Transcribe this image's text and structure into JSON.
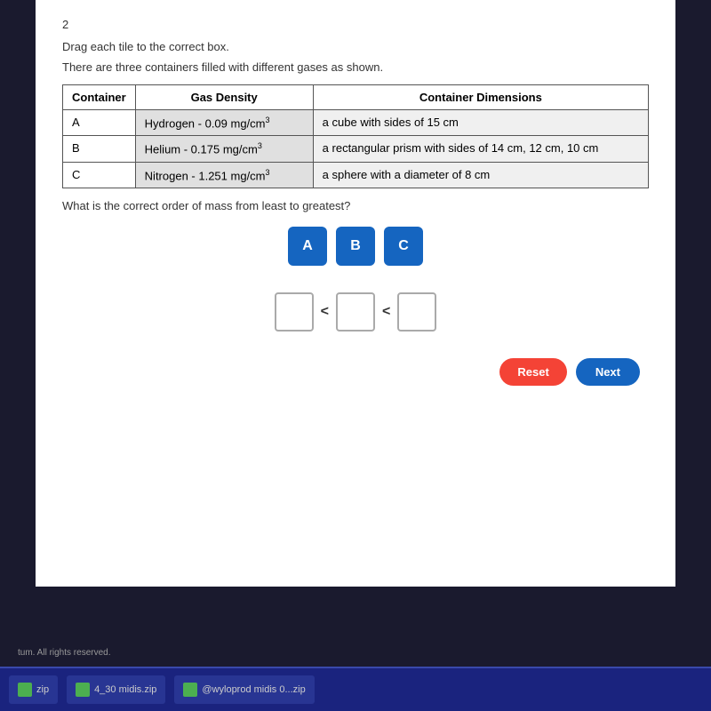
{
  "page": {
    "question_number": "2",
    "instruction": "Drag each tile to the correct box.",
    "sub_instruction": "There are three containers filled with different gases as shown.",
    "question_text": "What is the correct order of mass from least to greatest?"
  },
  "table": {
    "headers": [
      "Container",
      "Gas Density",
      "Container Dimensions"
    ],
    "rows": [
      {
        "container": "A",
        "gas_density": "Hydrogen - 0.09 mg/cm³",
        "dimensions": "a cube with sides of 15 cm"
      },
      {
        "container": "B",
        "gas_density": "Helium - 0.175 mg/cm³",
        "dimensions": "a rectangular prism with sides of 14 cm, 12 cm, 10 cm"
      },
      {
        "container": "C",
        "gas_density": "Nitrogen - 1.251 mg/cm³",
        "dimensions": "a sphere with a diameter of 8 cm"
      }
    ]
  },
  "tiles": [
    "A",
    "B",
    "C"
  ],
  "less_than_symbols": [
    "<",
    "<"
  ],
  "buttons": {
    "reset_label": "Reset",
    "next_label": "Next"
  },
  "taskbar": {
    "items": [
      {
        "label": "zip",
        "icon_type": "green"
      },
      {
        "label": "4_30 midis.zip",
        "icon_type": "green"
      },
      {
        "label": "@wyloprod midis 0...zip",
        "icon_type": "green"
      }
    ]
  },
  "copyright": "tum. All rights reserved."
}
